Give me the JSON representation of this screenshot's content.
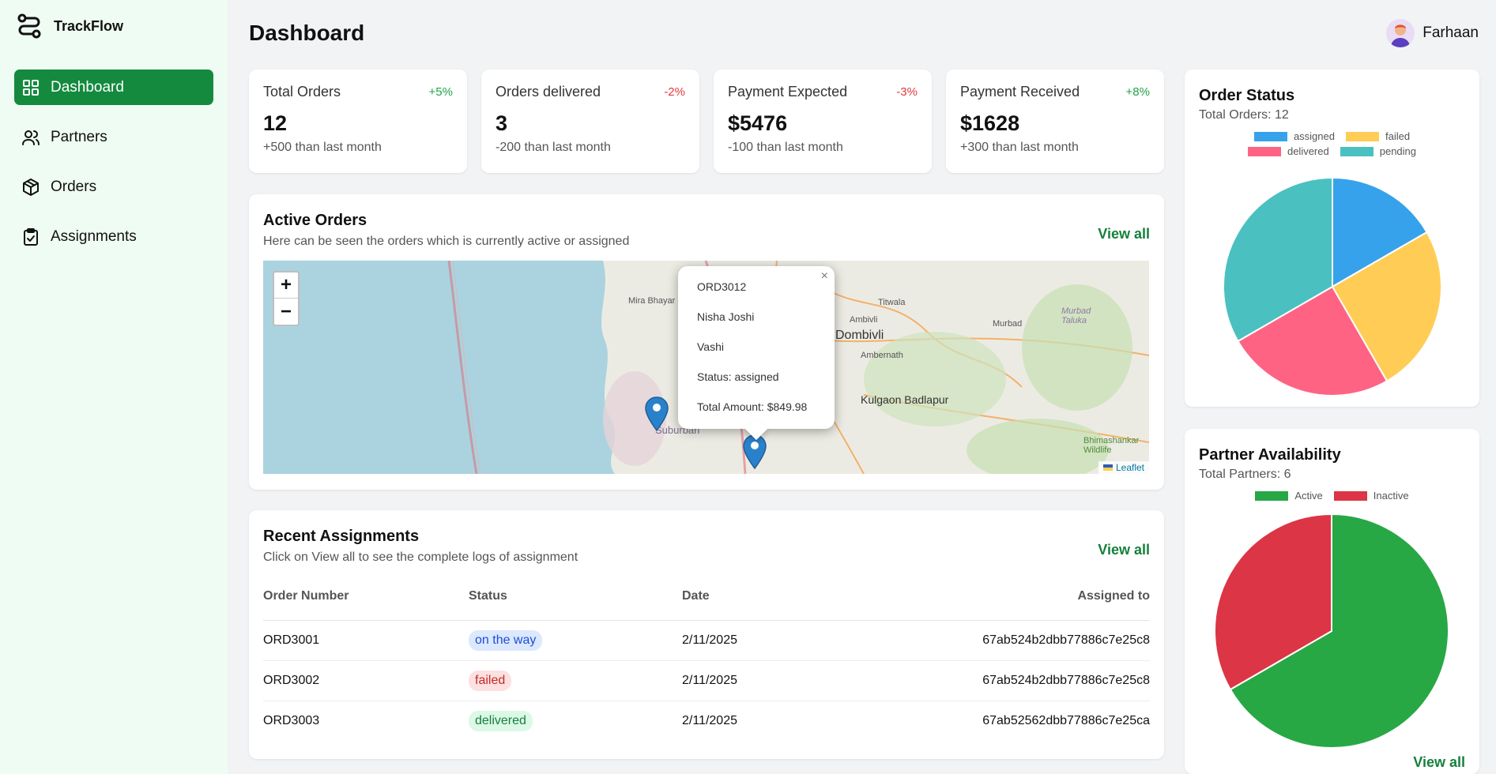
{
  "app": {
    "name": "TrackFlow"
  },
  "sidebar": {
    "items": [
      {
        "label": "Dashboard",
        "icon": "grid-icon",
        "active": true
      },
      {
        "label": "Partners",
        "icon": "users-icon",
        "active": false
      },
      {
        "label": "Orders",
        "icon": "package-icon",
        "active": false
      },
      {
        "label": "Assignments",
        "icon": "clipboard-check-icon",
        "active": false
      }
    ]
  },
  "header": {
    "title": "Dashboard",
    "user_name": "Farhaan"
  },
  "stats": [
    {
      "label": "Total Orders",
      "delta": "+5%",
      "value": "12",
      "sub": "+500 than last month"
    },
    {
      "label": "Orders delivered",
      "delta": "-2%",
      "value": "3",
      "sub": "-200 than last month"
    },
    {
      "label": "Payment Expected",
      "delta": "-3%",
      "value": "$5476",
      "sub": "-100 than last month"
    },
    {
      "label": "Payment Received",
      "delta": "+8%",
      "value": "$1628",
      "sub": "+300 than last month"
    }
  ],
  "active_orders": {
    "title": "Active Orders",
    "subtitle": "Here can be seen the orders which is currently active or assigned",
    "view_all": "View all",
    "map": {
      "zoom_in": "+",
      "zoom_out": "−",
      "attribution": "Leaflet",
      "places": [
        "Mira Bhayar",
        "Titwala",
        "Ambivli",
        "Murbad",
        "Dombivli",
        "Ambernath",
        "Kulgaon Badlapur",
        "Bhimashankar Wildlife",
        "Suburban",
        "Murbad Taluka"
      ],
      "popup": {
        "order": "ORD3012",
        "name": "Nisha Joshi",
        "location": "Vashi",
        "status": "Status: assigned",
        "total": "Total Amount: $849.98",
        "close": "×"
      }
    }
  },
  "recent_assignments": {
    "title": "Recent Assignments",
    "subtitle": "Click on View all to see the complete logs of assignment",
    "view_all": "View all",
    "columns": [
      "Order Number",
      "Status",
      "Date",
      "Assigned to"
    ],
    "rows": [
      {
        "order": "ORD3001",
        "status": "on the way",
        "date": "2/11/2025",
        "assigned_to": "67ab524b2dbb77886c7e25c8"
      },
      {
        "order": "ORD3002",
        "status": "failed",
        "date": "2/11/2025",
        "assigned_to": "67ab524b2dbb77886c7e25c8"
      },
      {
        "order": "ORD3003",
        "status": "delivered",
        "date": "2/11/2025",
        "assigned_to": "67ab52562dbb77886c7e25ca"
      }
    ]
  },
  "chart_data": [
    {
      "type": "pie",
      "title": "Order Status",
      "subtitle": "Total Orders: 12",
      "categories": [
        "assigned",
        "failed",
        "delivered",
        "pending"
      ],
      "values": [
        2,
        3,
        3,
        4
      ],
      "colors": [
        "#36a2eb",
        "#ffcd56",
        "#ff6384",
        "#4bc0c0"
      ],
      "legend": "top"
    },
    {
      "type": "pie",
      "title": "Partner Availability",
      "subtitle": "Total Partners: 6",
      "categories": [
        "Active",
        "Inactive"
      ],
      "values": [
        4,
        2
      ],
      "colors": [
        "#28a745",
        "#dc3545"
      ],
      "legend": "top",
      "view_all": "View all"
    }
  ],
  "colors": {
    "accent": "#148a3e",
    "sidebar_bg": "#effcf3",
    "page_bg": "#f2f3f5",
    "positive": "#22a34a",
    "negative": "#e0393e"
  }
}
